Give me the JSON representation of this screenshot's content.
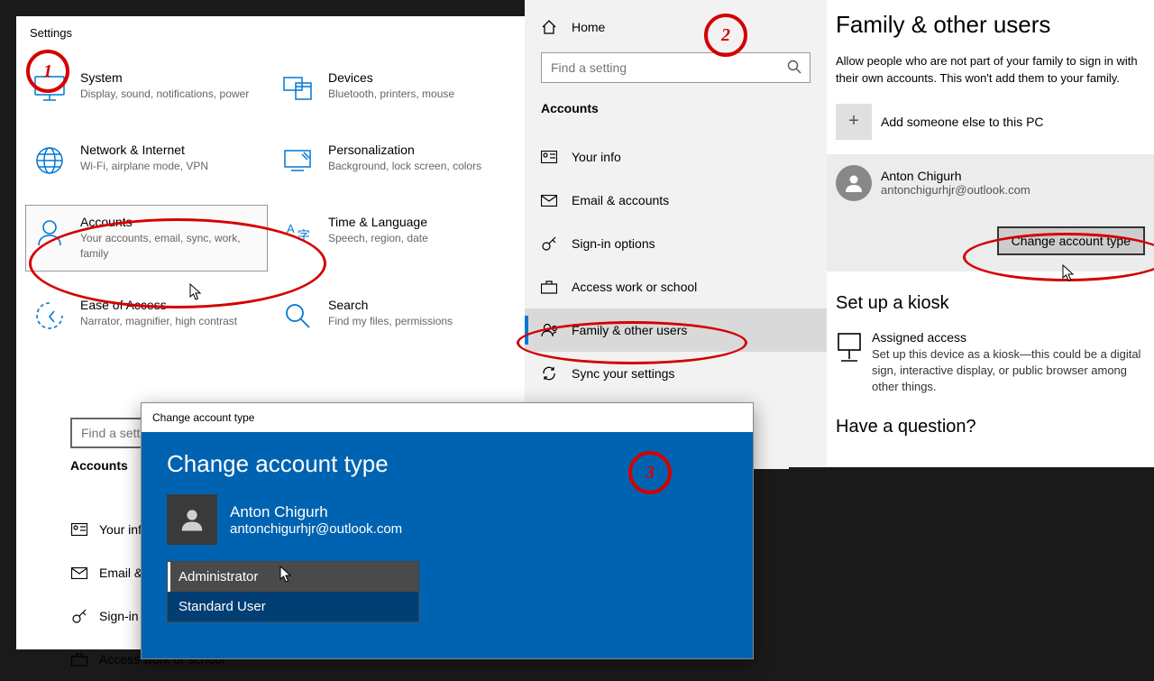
{
  "panel1": {
    "title": "Settings",
    "tiles": [
      {
        "title": "System",
        "desc": "Display, sound, notifications, power"
      },
      {
        "title": "Devices",
        "desc": "Bluetooth, printers, mouse"
      },
      {
        "title": "Network & Internet",
        "desc": "Wi-Fi, airplane mode, VPN"
      },
      {
        "title": "Personalization",
        "desc": "Background, lock screen, colors"
      },
      {
        "title": "Accounts",
        "desc": "Your accounts, email, sync, work, family"
      },
      {
        "title": "Time & Language",
        "desc": "Speech, region, date"
      },
      {
        "title": "Ease of Access",
        "desc": "Narrator, magnifier, high contrast"
      },
      {
        "title": "Search",
        "desc": "Find my files, permissions"
      }
    ],
    "search_placeholder": "Find a setting",
    "accounts_label": "Accounts",
    "nav": [
      "Your info",
      "Email & accounts",
      "Sign-in options",
      "Access work or school"
    ]
  },
  "panel2": {
    "home": "Home",
    "search_placeholder": "Find a setting",
    "heading": "Accounts",
    "items": [
      "Your info",
      "Email & accounts",
      "Sign-in options",
      "Access work or school",
      "Family & other users",
      "Sync your settings"
    ]
  },
  "panel3": {
    "title": "Family & other users",
    "desc": "Allow people who are not part of your family to sign in with their own accounts. This won't add them to your family.",
    "add_label": "Add someone else to this PC",
    "user": {
      "name": "Anton Chigurh",
      "email": "antonchigurhjr@outlook.com"
    },
    "change_btn": "Change account type",
    "kiosk_heading": "Set up a kiosk",
    "kiosk_title": "Assigned access",
    "kiosk_desc": "Set up this device as a kiosk—this could be a digital sign, interactive display, or public browser among other things.",
    "question": "Have a question?"
  },
  "dialog": {
    "titlebar": "Change account type",
    "title": "Change account type",
    "user": {
      "name": "Anton Chigurh",
      "email": "antonchigurhjr@outlook.com"
    },
    "options": [
      "Administrator",
      "Standard User"
    ]
  },
  "annotations": {
    "1": "1",
    "2": "2",
    "3": "3"
  }
}
